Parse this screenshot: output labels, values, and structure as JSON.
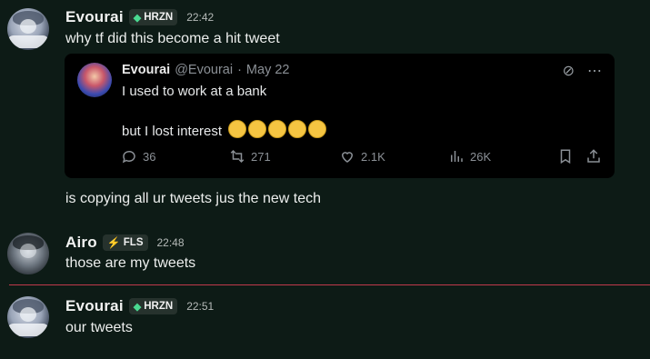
{
  "messages": [
    {
      "user": "Evourai",
      "tag": "HRZN",
      "time": "22:42",
      "text": "why tf did this become a hit tweet"
    },
    {
      "text": "is copying all ur tweets jus the new tech"
    },
    {
      "user": "Airo",
      "tag": "FLS",
      "time": "22:48",
      "text": "those are my tweets"
    },
    {
      "user": "Evourai",
      "tag": "HRZN",
      "time": "22:51",
      "text": "our tweets"
    }
  ],
  "embed": {
    "name": "Evourai",
    "handle": "@Evourai",
    "date": "May 22",
    "line1": "I used to work at a bank",
    "line2": "but I lost interest",
    "replies": "36",
    "retweets": "271",
    "likes": "2.1K",
    "views": "26K"
  },
  "colors": {
    "background": "#0d1b16",
    "divider": "#c0394b",
    "hrzn_gem": "#4ad991",
    "fls_bolt": "#a98bff"
  },
  "icons": [
    "grok-icon",
    "more-icon",
    "reply-icon",
    "retweet-icon",
    "like-icon",
    "views-icon",
    "bookmark-icon",
    "share-icon"
  ]
}
